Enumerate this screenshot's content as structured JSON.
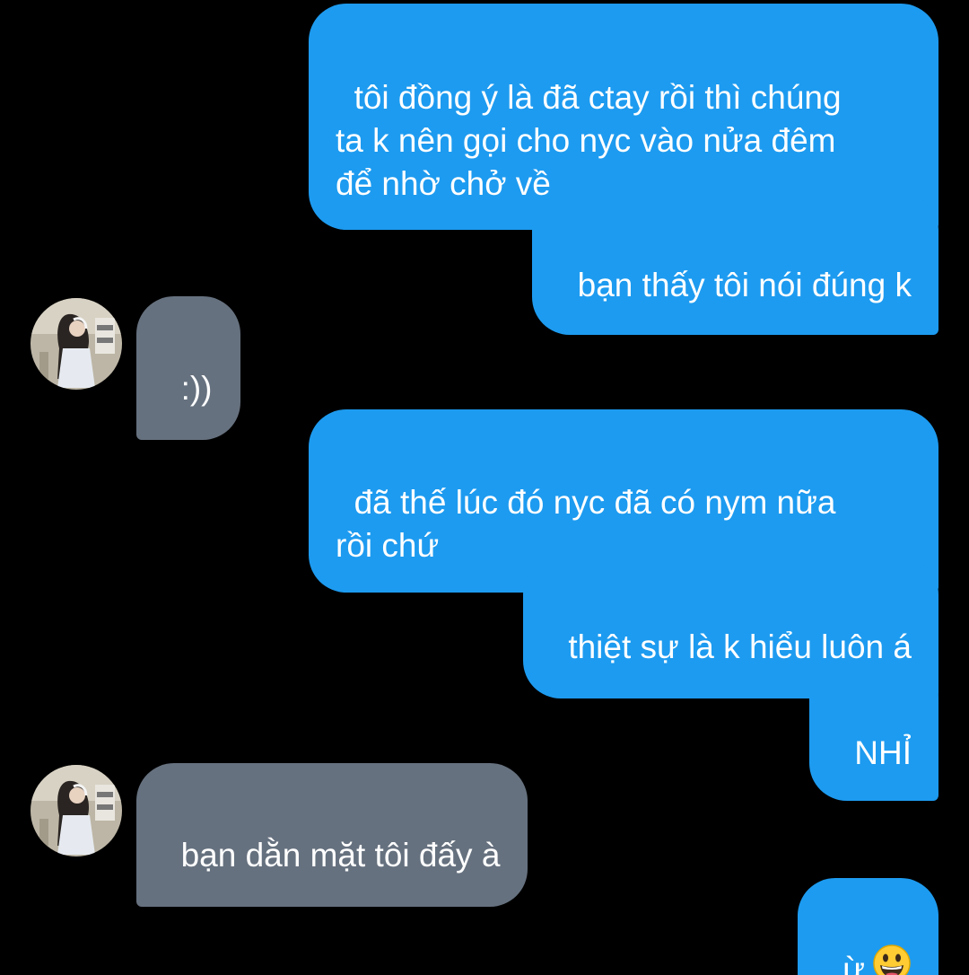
{
  "conversation": {
    "messages": [
      {
        "sender": "me",
        "text": "tôi đồng ý là đã ctay rồi thì chúng\nta k nên gọi cho nyc vào nửa đêm\nđể nhờ chở về"
      },
      {
        "sender": "me",
        "text": "bạn thấy tôi nói đúng k"
      },
      {
        "sender": "them",
        "text": ":))"
      },
      {
        "sender": "me",
        "text": "đã thế lúc đó nyc đã có nym nữa\nrồi chứ"
      },
      {
        "sender": "me",
        "text": "thiệt sự là k hiểu luôn á"
      },
      {
        "sender": "me",
        "text": "NHỈ"
      },
      {
        "sender": "them",
        "text": "bạn dằn mặt tôi đấy à"
      },
      {
        "sender": "me",
        "text": "ừ",
        "emoji": "grinning-face-emoji"
      }
    ]
  },
  "colors": {
    "background": "#000000",
    "outgoing_bubble": "#1d9bf0",
    "incoming_bubble": "#66717f",
    "text": "#ffffff"
  },
  "icons": {
    "avatar": "contact-avatar-photo",
    "emoji": "grinning-face-emoji"
  }
}
